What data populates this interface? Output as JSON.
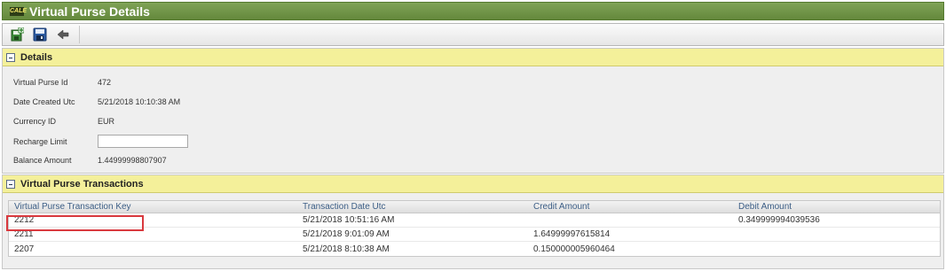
{
  "window": {
    "logo_text": "CALE",
    "title": "Virtual Purse Details"
  },
  "toolbar": {
    "buttons": [
      "save-new-icon",
      "save-icon",
      "back-icon"
    ]
  },
  "details": {
    "title": "Details",
    "fields": [
      {
        "label": "Virtual Purse Id",
        "value": "472"
      },
      {
        "label": "Date Created Utc",
        "value": "5/21/2018 10:10:38 AM"
      },
      {
        "label": "Currency ID",
        "value": "EUR"
      },
      {
        "label": "Recharge Limit",
        "value": ""
      },
      {
        "label": "Balance Amount",
        "value": "1.44999998807907"
      }
    ]
  },
  "transactions": {
    "title": "Virtual Purse Transactions",
    "columns": [
      "Virtual Purse Transaction Key",
      "Transaction Date Utc",
      "Credit Amount",
      "Debit Amount"
    ],
    "rows": [
      {
        "key": "2212",
        "date": "5/21/2018 10:51:16 AM",
        "credit": "",
        "debit": "0.349999994039536"
      },
      {
        "key": "2211",
        "date": "5/21/2018 9:01:09 AM",
        "credit": "1.64999997615814",
        "debit": ""
      },
      {
        "key": "2207",
        "date": "5/21/2018 8:10:38 AM",
        "credit": "0.150000005960464",
        "debit": ""
      }
    ]
  },
  "colors": {
    "title_bar": "#6b8f42",
    "section_header": "#f4f09a",
    "highlight": "#d9393e"
  }
}
